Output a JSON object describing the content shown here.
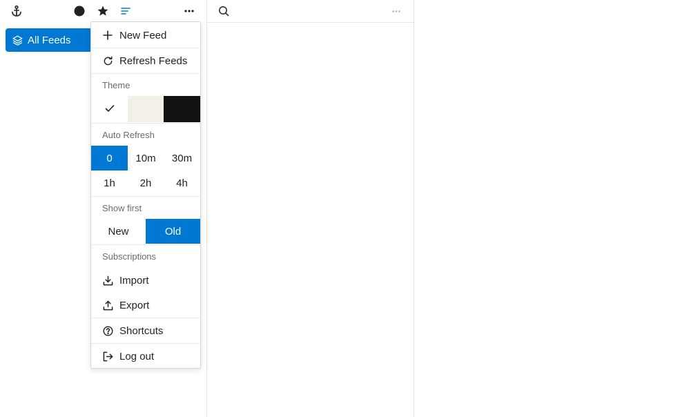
{
  "sidebar": {
    "all_feeds_label": "All Feeds"
  },
  "menu": {
    "new_feed": "New Feed",
    "refresh_feeds": "Refresh Feeds",
    "theme_header": "Theme",
    "theme_options": [
      {
        "name": "light",
        "color": "#ffffff",
        "selected": true
      },
      {
        "name": "sepia",
        "color": "#f3f0e8",
        "selected": false
      },
      {
        "name": "dark",
        "color": "#111111",
        "selected": false
      }
    ],
    "auto_refresh_header": "Auto Refresh",
    "auto_refresh_options": [
      "0",
      "10m",
      "30m",
      "1h",
      "2h",
      "4h"
    ],
    "auto_refresh_selected": "0",
    "show_first_header": "Show first",
    "show_first_options": [
      "New",
      "Old"
    ],
    "show_first_selected": "Old",
    "subscriptions_header": "Subscriptions",
    "import": "Import",
    "export": "Export",
    "shortcuts": "Shortcuts",
    "log_out": "Log out"
  },
  "colors": {
    "accent": "#0078d4",
    "sepia": "#f3f0e8",
    "dark": "#111111",
    "filter_active": "#0078d4"
  },
  "icons": {
    "toolbar_left": [
      "anchor-icon",
      "unread-circle-icon",
      "star-icon",
      "sort-lines-icon",
      "more-dots-icon"
    ],
    "toolbar_middle": [
      "search-icon",
      "more-dots-icon"
    ]
  }
}
